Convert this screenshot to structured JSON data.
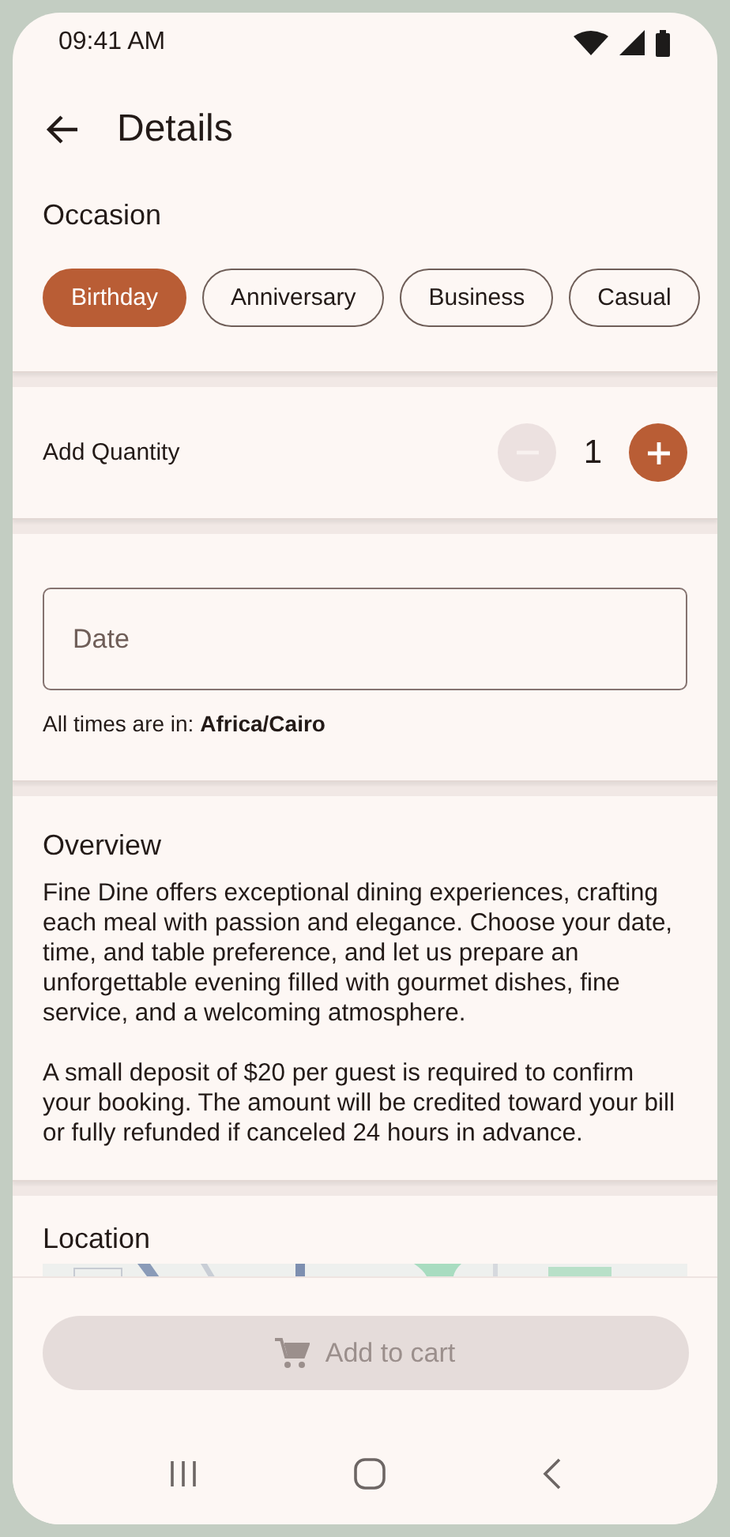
{
  "status_bar": {
    "time": "09:41 AM"
  },
  "header": {
    "title": "Details"
  },
  "occasion": {
    "title": "Occasion",
    "chips": [
      {
        "label": "Birthday",
        "selected": true
      },
      {
        "label": "Anniversary",
        "selected": false
      },
      {
        "label": "Business",
        "selected": false
      },
      {
        "label": "Casual",
        "selected": false
      }
    ]
  },
  "quantity": {
    "label": "Add Quantity",
    "value": "1",
    "decrease_disabled": true,
    "increase_disabled": false
  },
  "date": {
    "placeholder": "Date",
    "timezone_note": "All times are in: **Africa/Cairo**"
  },
  "overview": {
    "title": "Overview",
    "paragraphs": [
      "Fine Dine offers exceptional dining experiences, crafting each meal with passion and elegance. Choose your date, time, and table preference, and let us prepare an unforgettable evening filled with gourmet dishes, fine service, and a welcoming atmosphere.",
      "A small deposit of $20 per guest is required to confirm your booking. The amount will be credited toward your bill or fully refunded if canceled 24 hours in advance."
    ]
  },
  "location": {
    "title": "Location"
  },
  "cart_button": {
    "label": "Add to cart",
    "disabled": true
  }
}
